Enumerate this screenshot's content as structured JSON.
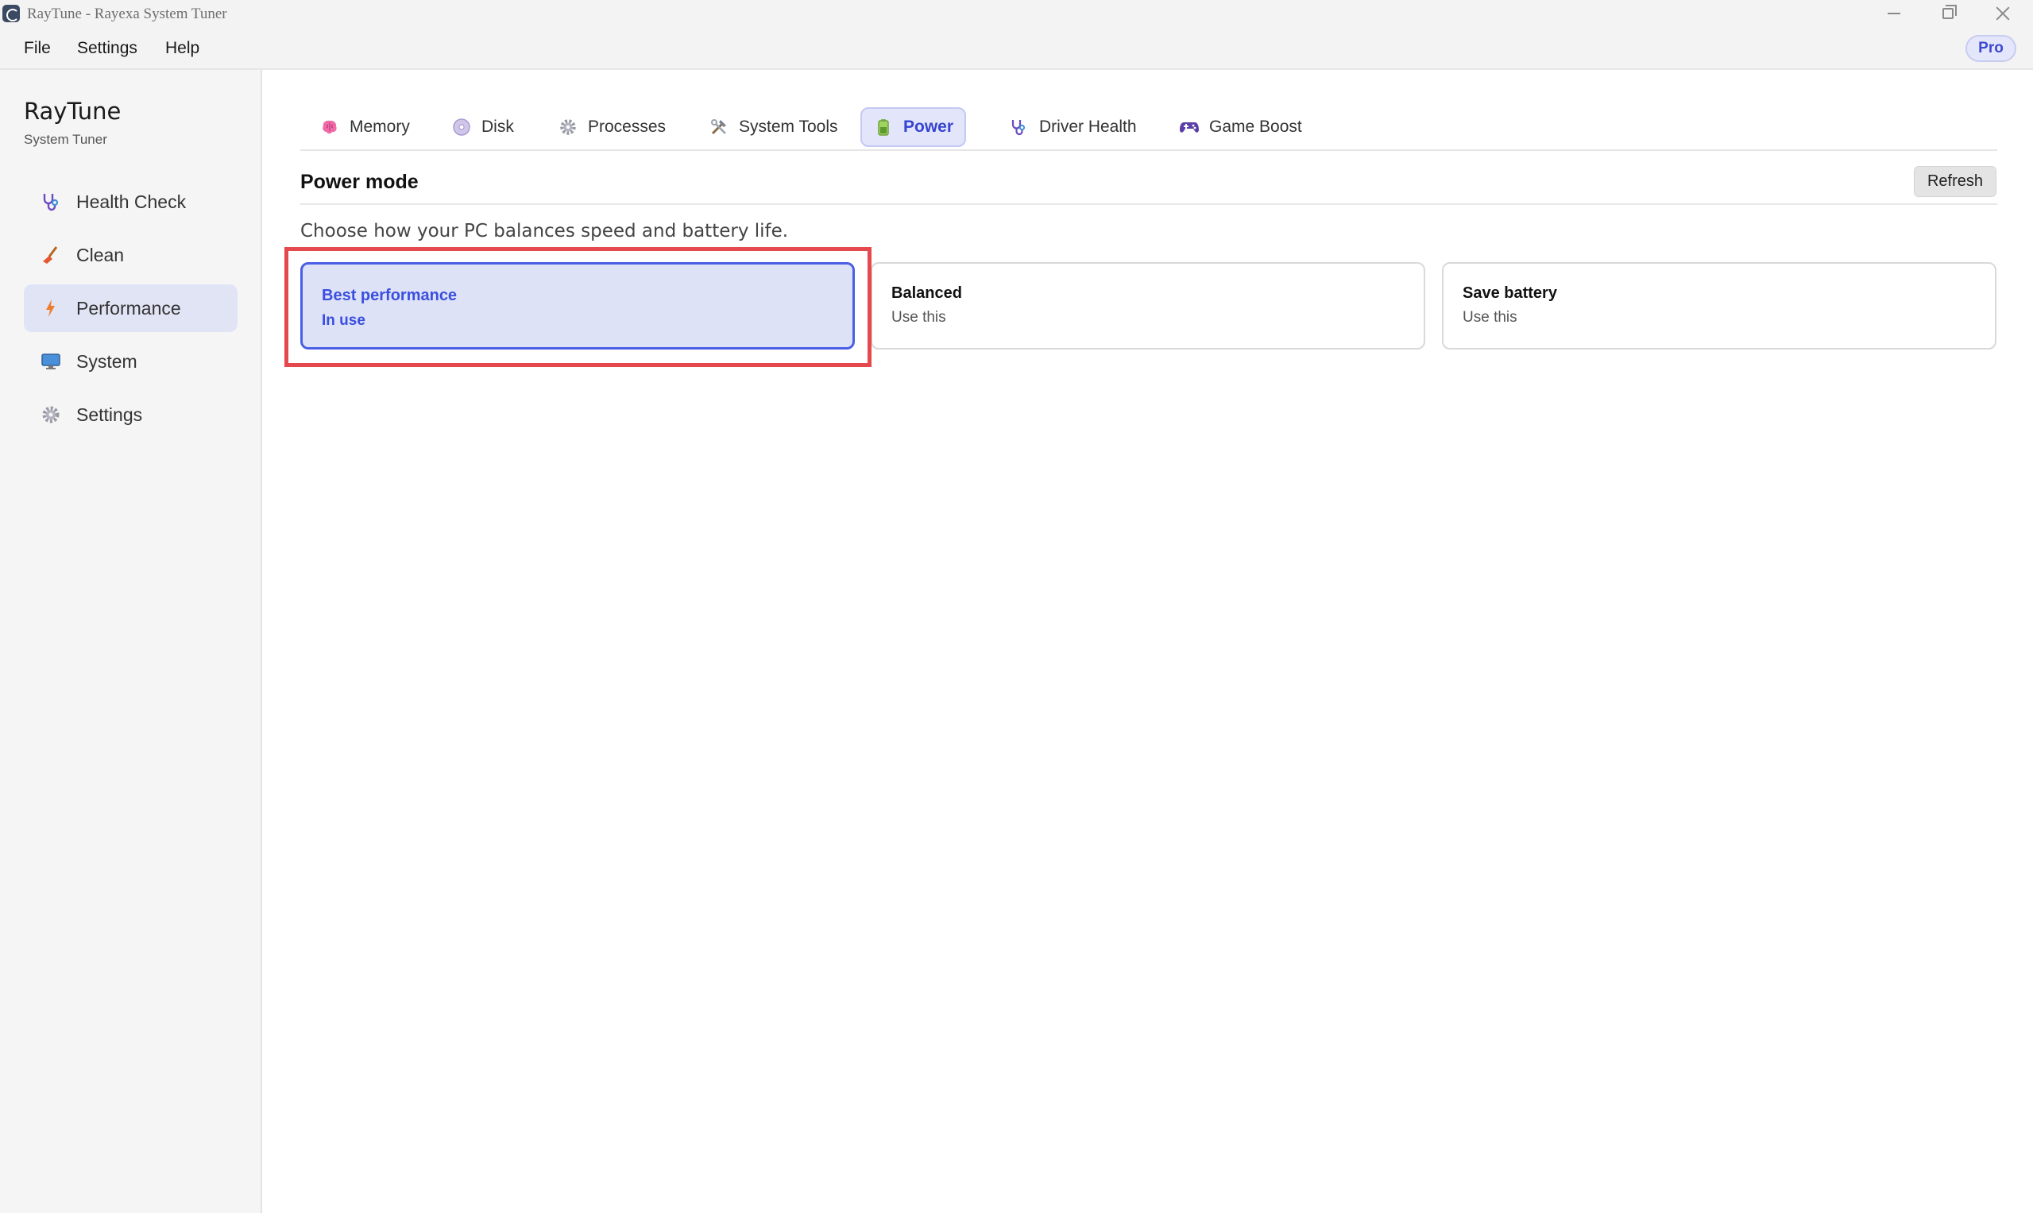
{
  "window": {
    "title": "RayTune - Rayexa System Tuner"
  },
  "menu": {
    "file": "File",
    "settings": "Settings",
    "help": "Help",
    "badge": "Pro"
  },
  "sidebar": {
    "brand": "RayTune",
    "subtitle": "System Tuner",
    "items": [
      {
        "label": "Health Check",
        "icon": "stethoscope-icon",
        "active": false
      },
      {
        "label": "Clean",
        "icon": "broom-icon",
        "active": false
      },
      {
        "label": "Performance",
        "icon": "lightning-icon",
        "active": true
      },
      {
        "label": "System",
        "icon": "monitor-icon",
        "active": false
      },
      {
        "label": "Settings",
        "icon": "gear-icon",
        "active": false
      }
    ]
  },
  "tabs": [
    {
      "label": "Memory",
      "icon": "brain-icon",
      "active": false
    },
    {
      "label": "Disk",
      "icon": "disc-icon",
      "active": false
    },
    {
      "label": "Processes",
      "icon": "gear-icon",
      "active": false
    },
    {
      "label": "System Tools",
      "icon": "tools-icon",
      "active": false
    },
    {
      "label": "Power",
      "icon": "battery-icon",
      "active": true
    },
    {
      "label": "Driver Health",
      "icon": "stethoscope-icon",
      "active": false
    },
    {
      "label": "Game Boost",
      "icon": "gamepad-icon",
      "active": false
    }
  ],
  "section": {
    "title": "Power mode",
    "refresh_label": "Refresh",
    "description": "Choose how your PC balances speed and battery life."
  },
  "power_modes": [
    {
      "title": "Best performance",
      "status": "In use",
      "selected": true
    },
    {
      "title": "Balanced",
      "status": "Use this",
      "selected": false
    },
    {
      "title": "Save battery",
      "status": "Use this",
      "selected": false
    }
  ],
  "colors": {
    "accent": "#3a4fe0",
    "selected_bg": "#dde2f7",
    "highlight": "#e5484d"
  }
}
